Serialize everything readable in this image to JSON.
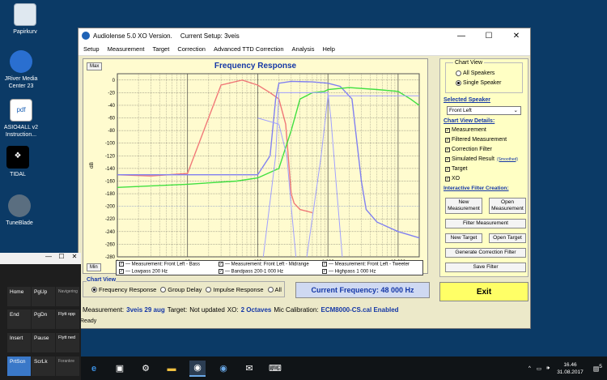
{
  "desktop": {
    "icons": [
      {
        "label": "Papirkurv"
      },
      {
        "label": "JRiver Media Center 23"
      },
      {
        "label": "ASIO4ALL v2 Instruction..."
      },
      {
        "label": "TIDAL"
      },
      {
        "label": "TuneBlade"
      }
    ]
  },
  "window": {
    "title": "Audiolense 5.0 XO Version.",
    "setup": "Current Setup: 3veis",
    "controls": [
      "—",
      "☐",
      "✕"
    ],
    "menu": [
      "Setup",
      "Measurement",
      "Target",
      "Correction",
      "Advanced TTD Correction",
      "Analysis",
      "Help"
    ]
  },
  "graph": {
    "title": "Frequency Response",
    "max_button": "Max",
    "min_button": "Min",
    "ylabel": "dB",
    "xlabel": "Frequency Hz",
    "yticks": [
      "0",
      "-20",
      "-40",
      "-60",
      "-80",
      "-100",
      "-120",
      "-140",
      "-160",
      "-180",
      "-200",
      "-220",
      "-240",
      "-260",
      "-280"
    ],
    "xticks": [
      "1",
      "10",
      "100",
      "1 000",
      "10 000"
    ]
  },
  "chart_data": {
    "type": "line",
    "title": "Frequency Response",
    "xlabel": "Frequency Hz",
    "ylabel": "dB",
    "xscale": "log",
    "xlim": [
      1,
      20000
    ],
    "ylim": [
      -280,
      10
    ],
    "grid": true,
    "series": [
      {
        "name": "Measurement: Front Left - Bass",
        "color": "#f07878",
        "x": [
          1,
          3,
          10,
          30,
          60,
          100,
          150,
          200,
          250,
          300,
          330,
          400,
          600
        ],
        "y": [
          -150,
          -152,
          -148,
          -8,
          0,
          -8,
          -20,
          -30,
          -70,
          -180,
          -195,
          -205,
          -210
        ]
      },
      {
        "name": "Measurement: Front Left - Midrange",
        "color": "#8080f0",
        "x": [
          1,
          10,
          100,
          150,
          180,
          200,
          300,
          600,
          1000,
          1500,
          2200,
          3000,
          3500,
          5000,
          10000,
          20000
        ],
        "y": [
          -150,
          -150,
          -150,
          -120,
          -30,
          -5,
          -2,
          -3,
          -5,
          -10,
          -30,
          -160,
          -205,
          -225,
          -240,
          -250
        ]
      },
      {
        "name": "Measurement: Front Left - Tweeter",
        "color": "#40e040",
        "x": [
          1,
          10,
          50,
          100,
          200,
          300,
          400,
          600,
          900,
          1000,
          2000,
          5000,
          10000,
          15000,
          20000
        ],
        "y": [
          -170,
          -165,
          -160,
          -155,
          -140,
          -80,
          -30,
          -20,
          -18,
          -15,
          -12,
          -15,
          -18,
          -30,
          -40
        ]
      },
      {
        "name": "Lowpass 200 Hz",
        "color": "#a0a0ff",
        "x": [
          100,
          200,
          260,
          300,
          350
        ],
        "y": [
          -60,
          -70,
          -120,
          -200,
          -280
        ]
      },
      {
        "name": "Bandpass 200-1 000 Hz",
        "color": "#a0a0ff",
        "x": [
          120,
          180,
          200,
          1000,
          1100,
          1300,
          1600
        ],
        "y": [
          -280,
          -120,
          -20,
          -20,
          -60,
          -160,
          -280
        ]
      },
      {
        "name": "Highpass 1 000 Hz",
        "color": "#a0a0ff",
        "x": [
          500,
          800,
          1000,
          20000
        ],
        "y": [
          -280,
          -120,
          -25,
          -25
        ]
      }
    ]
  },
  "legend": [
    {
      "label": "Measurement: Front Left - Bass"
    },
    {
      "label": "Measurement: Front Left - Midrange"
    },
    {
      "label": "Measurement: Front Left - Tweeter"
    },
    {
      "label": "Lowpass 200 Hz"
    },
    {
      "label": "Bandpass 200-1 000 Hz"
    },
    {
      "label": "Highpass 1 000 Hz"
    }
  ],
  "chart_view": {
    "group_label": "Chart View",
    "options": [
      "Frequency Response",
      "Group Delay",
      "Impulse Response",
      "All"
    ],
    "selected": "Frequency Response"
  },
  "current_frequency": "Current Frequency: 48 000 Hz",
  "status": {
    "measurement_label": "Measurement:",
    "measurement_value": "3veis 29 aug",
    "target_label": "Target:",
    "target_value": "Not updated",
    "xo_label": "XO:",
    "xo_value": "2 Octaves",
    "mic_label": "Mic Calibration:",
    "mic_value": "ECM8000-CS.cal Enabled",
    "ready": "Ready"
  },
  "right_panel": {
    "chart_view_title": "Chart View",
    "all_speakers": "All Speakers",
    "single_speaker": "Single Speaker",
    "selected_speaker_title": "Selected Speaker",
    "speaker_value": "Front Left",
    "details_title": "Chart View Details:",
    "details": [
      "Measurement",
      "Filtered Measurement",
      "Correction Filter",
      "Simulated Result",
      "Target",
      "XO"
    ],
    "smoothed": "(Smoothed)",
    "filter_creation_title": "Interactive Filter Creation:",
    "new_measurement": "New Measurement",
    "open_measurement": "Open Measurement",
    "filter_measurement": "Filter Measurement",
    "new_target": "New Target",
    "open_target": "Open Target",
    "generate_filter": "Generate Correction Filter",
    "save_filter": "Save Filter"
  },
  "exit_label": "Exit",
  "keyboard": {
    "keys": [
      {
        "label": "Home"
      },
      {
        "label": "PgUp"
      },
      {
        "label": "Navigering"
      },
      {
        "label": "End"
      },
      {
        "label": "PgDn"
      },
      {
        "label": "Flytt opp"
      },
      {
        "label": "Insert"
      },
      {
        "label": "Pause"
      },
      {
        "label": "Flytt ned"
      },
      {
        "label": "PrtScn"
      },
      {
        "label": "ScrLk"
      },
      {
        "label": "Forankre"
      }
    ]
  },
  "taskbar": {
    "time": "16.46",
    "date": "31.08.2017",
    "notifications": "5"
  }
}
